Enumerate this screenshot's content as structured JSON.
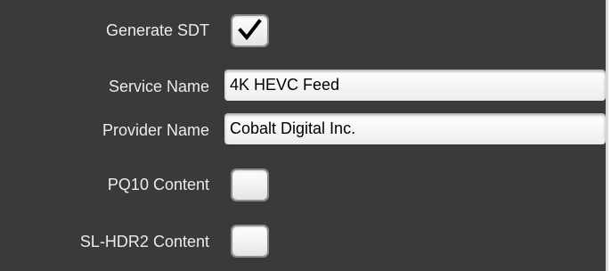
{
  "form": {
    "generate_sdt": {
      "label": "Generate SDT",
      "checked": true
    },
    "service_name": {
      "label": "Service Name",
      "value": "4K HEVC Feed"
    },
    "provider_name": {
      "label": "Provider Name",
      "value": "Cobalt Digital Inc."
    },
    "pq10_content": {
      "label": "PQ10 Content",
      "checked": false
    },
    "sl_hdr2_content": {
      "label": "SL-HDR2 Content",
      "checked": false
    }
  },
  "colors": {
    "panel_background": "#3a3a3a",
    "label_text": "#ececec",
    "field_background": "#f4f4f4"
  }
}
